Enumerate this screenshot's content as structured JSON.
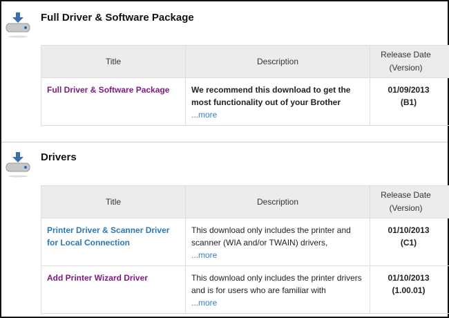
{
  "sections": [
    {
      "heading": "Full Driver & Software Package",
      "columns": {
        "title": "Title",
        "description": "Description",
        "release_line1": "Release Date",
        "release_line2": "(Version)"
      },
      "rows": [
        {
          "title": "Full Driver & Software Package",
          "description": "We recommend this download to get the most functionality out of your Brother",
          "more": "...more",
          "date": "01/09/2013",
          "version": "(B1)"
        }
      ]
    },
    {
      "heading": "Drivers",
      "columns": {
        "title": "Title",
        "description": "Description",
        "release_line1": "Release Date",
        "release_line2": "(Version)"
      },
      "rows": [
        {
          "title": "Printer Driver & Scanner Driver for Local Connection",
          "description": "This download only includes the printer and scanner (WIA and/or TWAIN) drivers,",
          "more": "...more",
          "date": "01/10/2013",
          "version": "(C1)"
        },
        {
          "title": "Add Printer Wizard Driver",
          "description": "This download only includes the printer drivers and is for users who are familiar with",
          "more": "...more",
          "date": "01/10/2013",
          "version": "(1.00.01)"
        }
      ]
    }
  ]
}
